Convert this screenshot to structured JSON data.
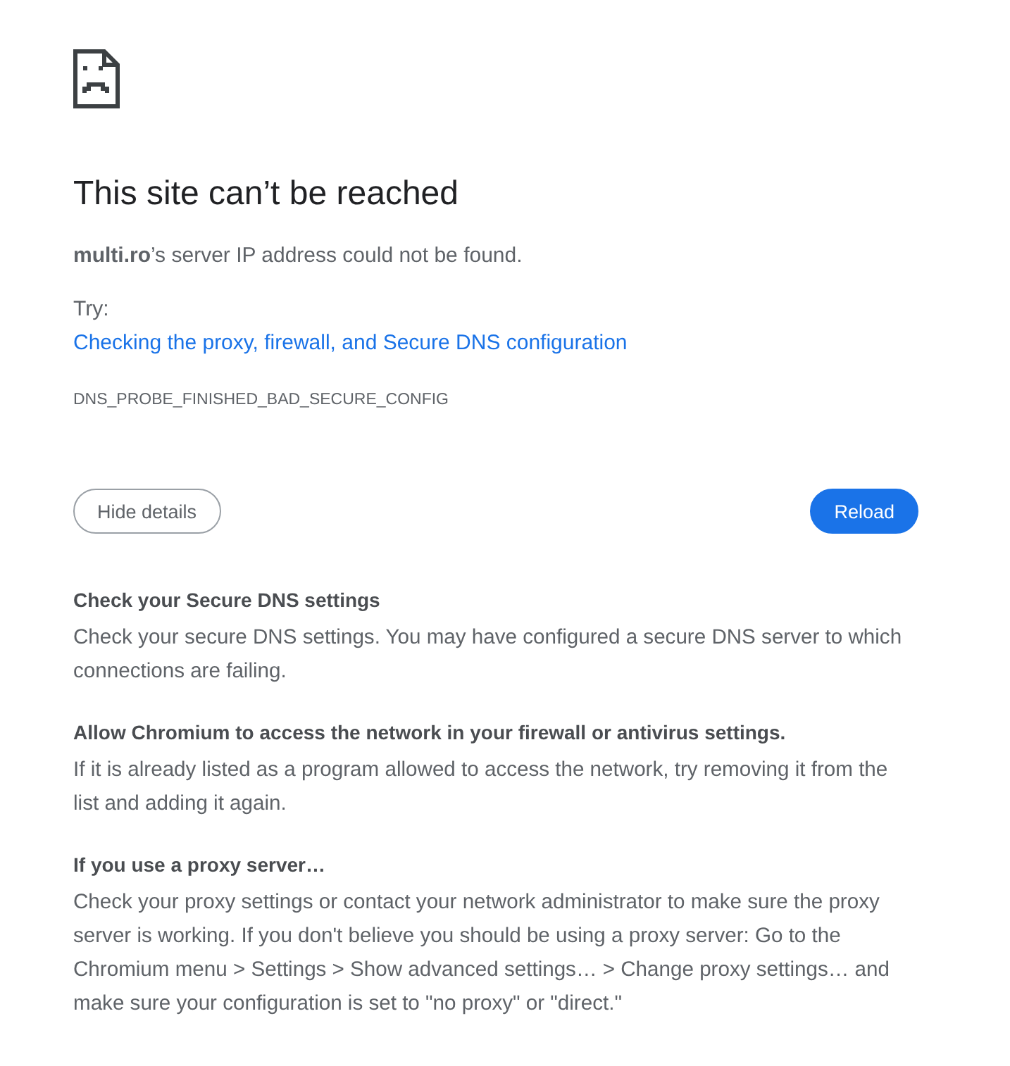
{
  "heading": "This site can’t be reached",
  "summary": "**multi.ro**’s server IP address could not be found.",
  "suggestions": {
    "label": "Try:",
    "links": [
      "Checking the proxy, firewall, and Secure DNS configuration"
    ]
  },
  "error_code": "DNS_PROBE_FINISHED_BAD_SECURE_CONFIG",
  "buttons": [
    {
      "label": "Hide details",
      "kind": "secondary"
    },
    {
      "label": "Reload",
      "kind": "primary"
    }
  ],
  "details": [
    {
      "title": "Check your Secure DNS settings",
      "text": "Check your secure DNS settings. You may have configured a secure DNS server to which connections are failing."
    },
    {
      "title": "Allow Chromium to access the network in your firewall or antivirus settings.",
      "text": "If it is already listed as a program allowed to access the network, try removing it from the list and adding it again."
    },
    {
      "title": "If you use a proxy server…",
      "text": "Check your proxy settings or contact your network administrator to make sure the proxy server is working. If you don't believe you should be using a proxy server: Go to the Chromium menu > Settings > Show advanced settings… > Change proxy settings… and make sure your configuration is set to \"no proxy\" or \"direct.\""
    }
  ]
}
